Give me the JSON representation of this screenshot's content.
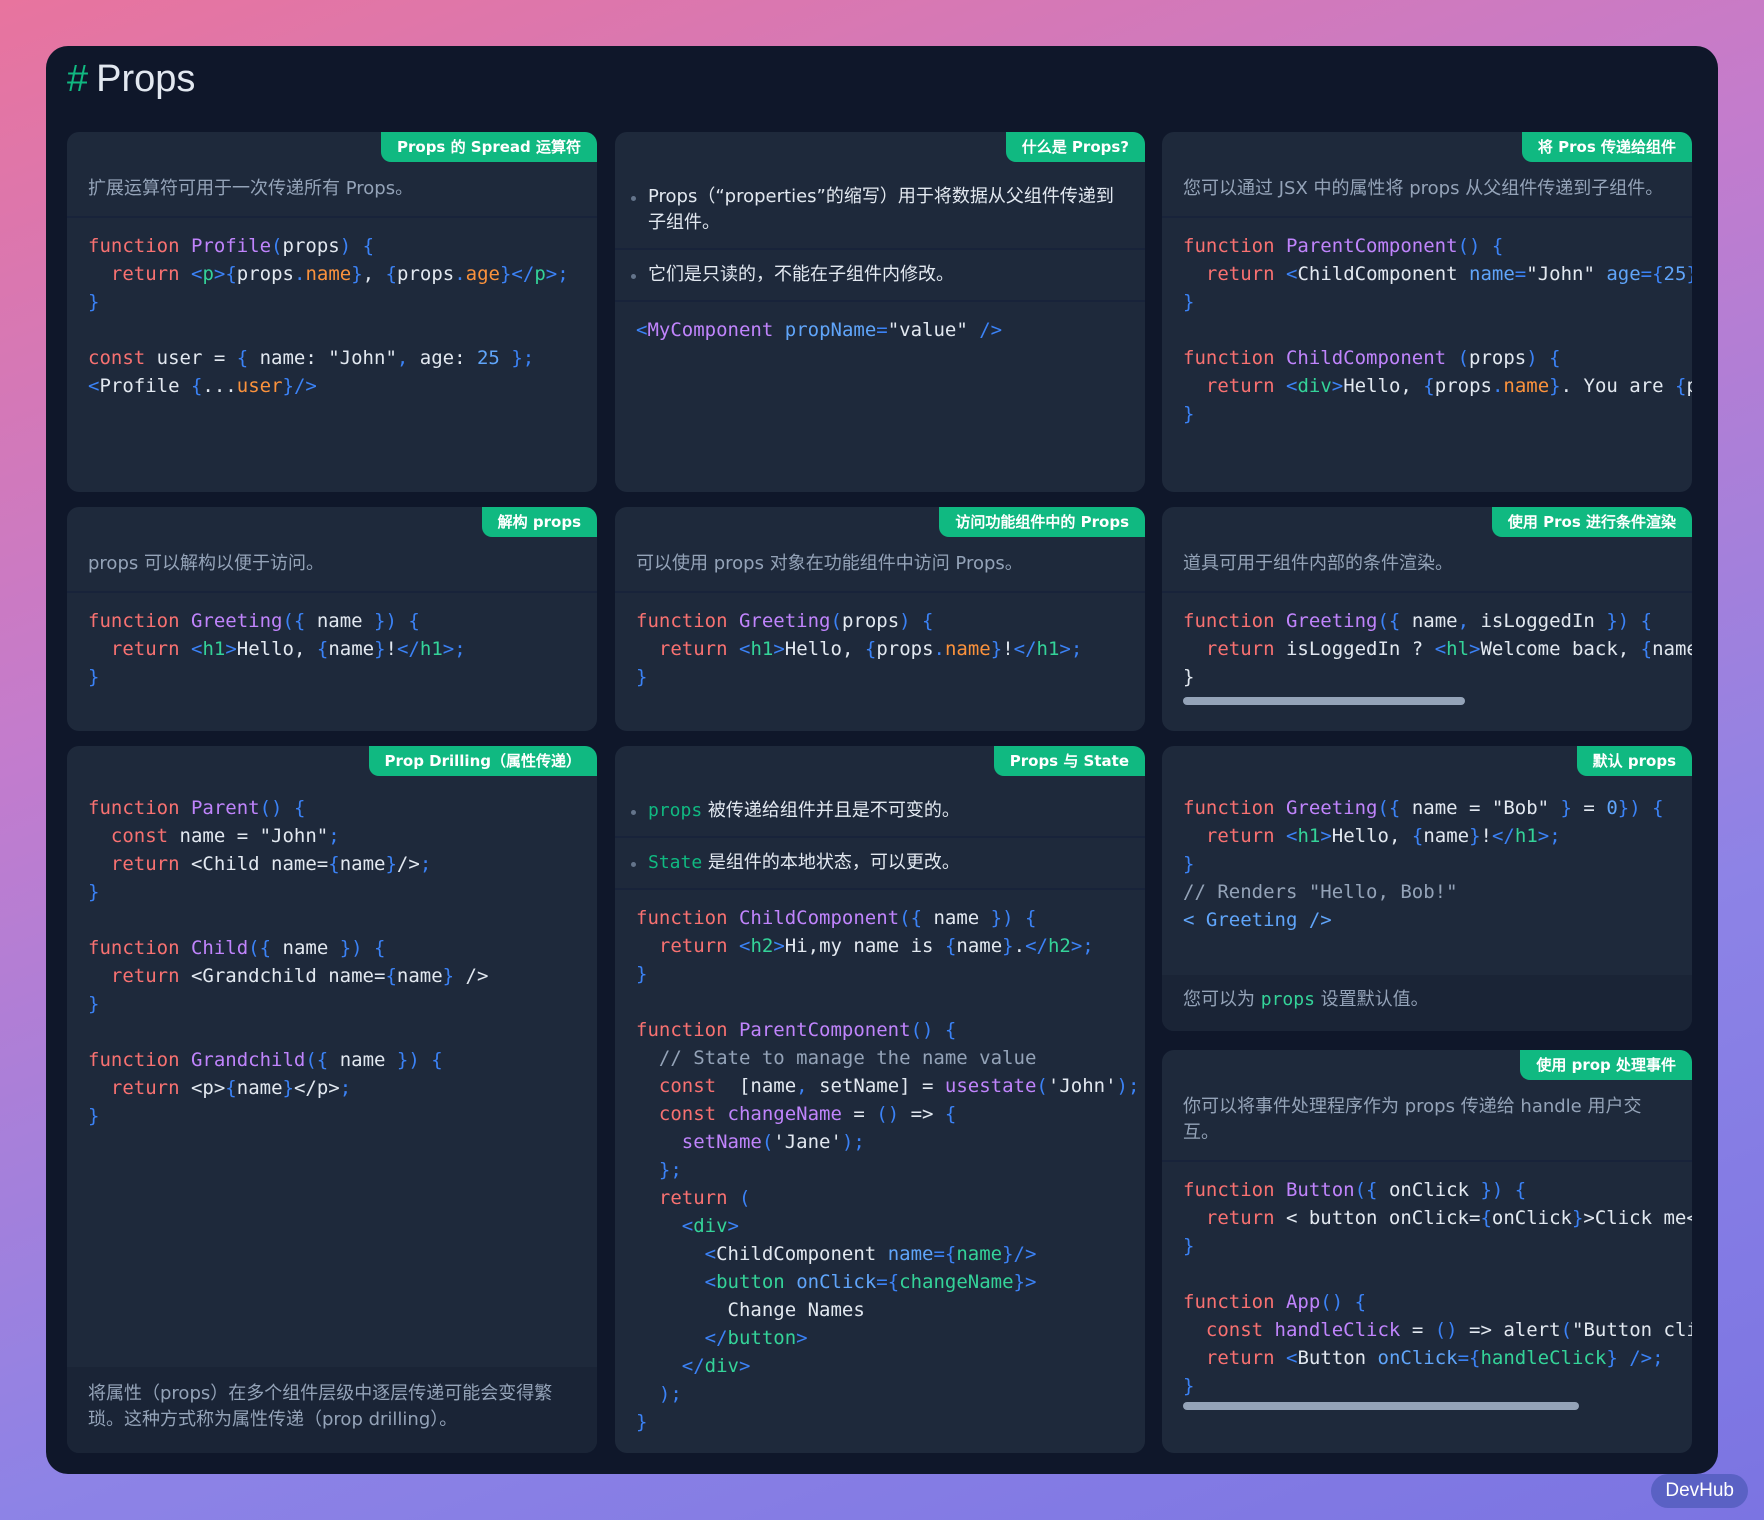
{
  "page": {
    "hash": "#",
    "title": "Props"
  },
  "watermark": "DevHub",
  "cards": {
    "spread": {
      "tag": "Props 的 Spread 运算符",
      "desc": "扩展运算符可用于一次传递所有 Props。"
    },
    "what": {
      "tag": "什么是 Props?",
      "bullet1": "Props（“properties”的缩写）用于将数据从父组件传递到子组件。",
      "bullet2": "它们是只读的，不能在子组件内修改。"
    },
    "pass": {
      "tag": "将 Pros 传递给组件",
      "desc": "您可以通过 JSX 中的属性将 props 从父组件传递到子组件。"
    },
    "destructure": {
      "tag": "解构 props",
      "desc": "props 可以解构以便于访问。"
    },
    "access": {
      "tag": "访问功能组件中的 Props",
      "desc": "可以使用 props 对象在功能组件中访问 Props。"
    },
    "conditional": {
      "tag": "使用 Pros 进行条件渲染",
      "desc": "道具可用于组件内部的条件渲染。"
    },
    "drilling": {
      "tag": "Prop Drilling（属性传递）",
      "desc": "将属性（props）在多个组件层级中逐层传递可能会变得繁琐。这种方式称为属性传递（prop drilling）。"
    },
    "state": {
      "tag": "Props 与 State",
      "bullet1_kw": "props",
      "bullet1_text": " 被传递给组件并且是不可变的。",
      "bullet2_kw": "State",
      "bullet2_text": " 是组件的本地状态，可以更改。"
    },
    "defaults": {
      "tag": "默认 props",
      "desc_prefix": "您可以为 ",
      "desc_kw": "props",
      "desc_suffix": " 设置默认值。"
    },
    "events": {
      "tag": "使用 prop 处理事件",
      "desc": "你可以将事件处理程序作为 props 传递给 handle 用户交互。"
    }
  },
  "colors": {
    "accent": "#10b981",
    "window_bg": "#0f172a",
    "card_bg": "#1e293b"
  }
}
